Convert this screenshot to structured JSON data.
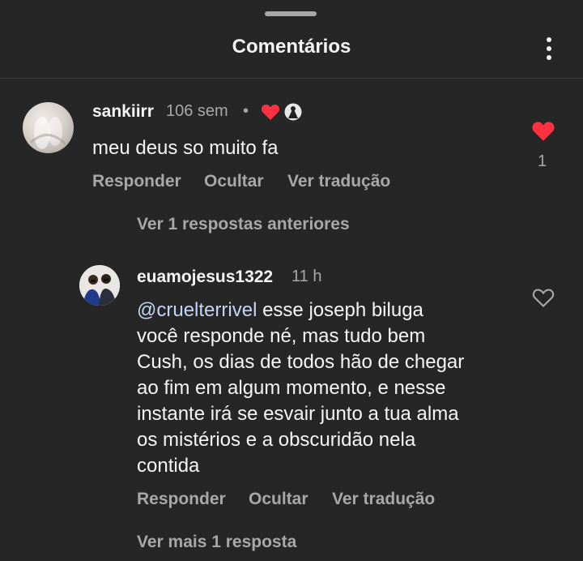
{
  "header": {
    "title": "Comentários"
  },
  "comments": [
    {
      "username": "sankiirr",
      "time": "106 sem",
      "separator": "•",
      "text": "meu deus so muito fa",
      "actions": {
        "reply": "Responder",
        "hide": "Ocultar",
        "translate": "Ver tradução"
      },
      "likes": "1",
      "liked": true
    }
  ],
  "replies_prev": "Ver 1 respostas anteriores",
  "reply": {
    "username": "euamojesus1322",
    "time": "11 h",
    "mention": "@cruelterrivel",
    "text_lines": [
      " esse joseph biluga",
      "você responde né, mas tudo bem",
      "Cush, os dias de todos hão de chegar",
      "ao fim em algum momento, e nesse",
      "instante irá se esvair junto a tua alma",
      "os mistérios e a obscuridão nela",
      "contida"
    ],
    "actions": {
      "reply": "Responder",
      "hide": "Ocultar",
      "translate": "Ver tradução"
    },
    "liked": false
  },
  "replies_more": "Ver mais 1 resposta",
  "colors": {
    "background": "#262626",
    "heart": "#ff3040",
    "mention": "#c3d6f7",
    "secondary_text": "#a8a8a8"
  }
}
